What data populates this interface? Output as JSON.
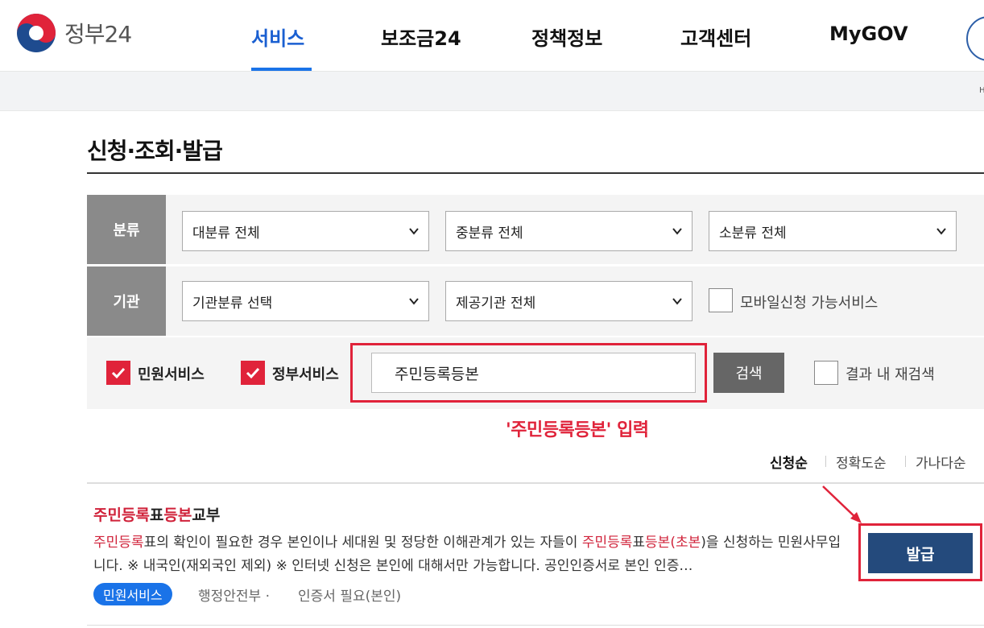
{
  "header": {
    "logo_text": "정부24",
    "nav": [
      "서비스",
      "보조금24",
      "정책정보",
      "고객센터",
      "MyGOV"
    ],
    "active_nav": "서비스"
  },
  "subbar": {
    "edge_text": "H"
  },
  "page": {
    "title": "신청·조회·발급"
  },
  "filters": {
    "category_label": "분류",
    "agency_label": "기관",
    "category_selects": [
      "대분류 전체",
      "중분류 전체",
      "소분류 전체"
    ],
    "agency_selects": [
      "기관분류 선택",
      "제공기관 전체"
    ],
    "mobile_checkbox_label": "모바일신청 가능서비스",
    "civil_service_label": "민원서비스",
    "gov_service_label": "정부서비스",
    "search_value": "주민등록등본",
    "search_button": "검색",
    "research_label": "결과 내 재검색"
  },
  "annotation": "'주민등록등본' 입력",
  "sort": {
    "options": [
      "신청순",
      "정확도순",
      "가나다순"
    ],
    "active": "신청순"
  },
  "result": {
    "title_parts": [
      "주민등록",
      "표",
      "등본",
      "교부"
    ],
    "desc_parts": [
      "주민등록",
      "표의 확인이 필요한 경우 본인이나 세대원 및 정당한 이해관계가 있는 자들이 ",
      "주민등록",
      "표",
      "등본",
      "(",
      "초본",
      ")을 신청하는 민원사무입니다. ※ 내국인(재외국인 제외) ※ 인터넷 신청은 본인에 대해서만 가능합니다. 공인인증서로 본인 인증…"
    ],
    "tag": "민원서비스",
    "agency": "행정안전부 ·",
    "requirement": "인증서 필요(본인)",
    "action_button": "발급"
  },
  "colors": {
    "accent_blue": "#1a73e8",
    "highlight_red": "#e0233a",
    "issue_button": "#244a7c"
  }
}
